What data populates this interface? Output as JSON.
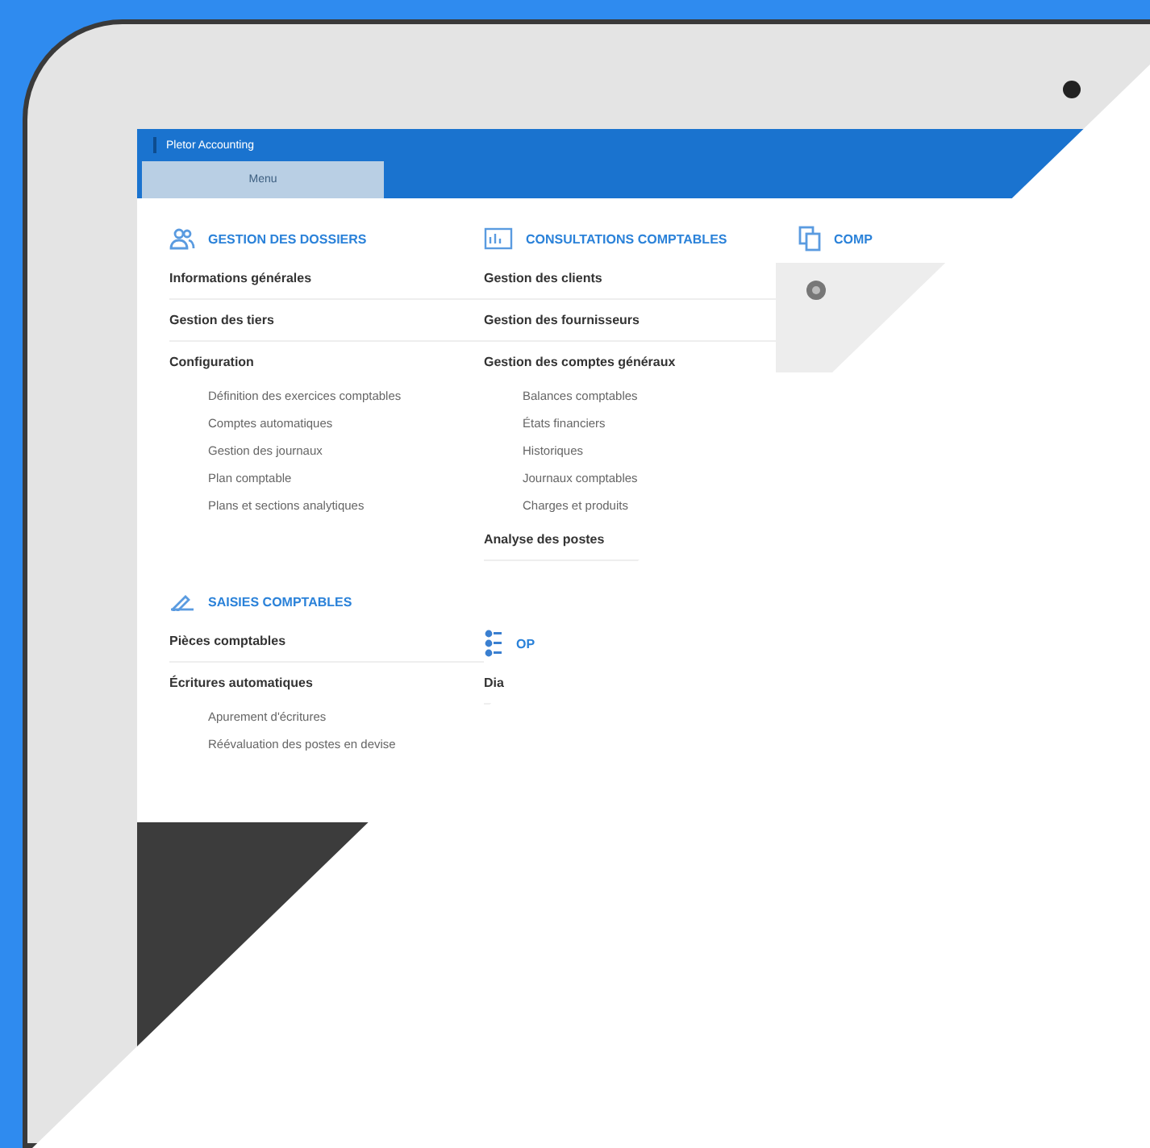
{
  "app": {
    "title": "Pletor Accounting",
    "tabs": [
      {
        "label": "Menu",
        "selected": true
      }
    ]
  },
  "columns": [
    {
      "sections": [
        {
          "title": "GESTION DES DOSSIERS",
          "items": [
            {
              "label": "Informations générales"
            },
            {
              "label": "Gestion des tiers"
            },
            {
              "label": "Configuration",
              "children": [
                {
                  "label": "Définition des exercices comptables"
                },
                {
                  "label": "Comptes automatiques"
                },
                {
                  "label": "Gestion des journaux"
                },
                {
                  "label": "Plan comptable"
                },
                {
                  "label": "Plans et sections analytiques"
                }
              ]
            }
          ]
        },
        {
          "title": "SAISIES COMPTABLES",
          "items": [
            {
              "label": "Pièces comptables"
            },
            {
              "label": "Écritures automatiques",
              "children": [
                {
                  "label": "Apurement d'écritures"
                },
                {
                  "label": "Réévaluation des postes en devise"
                }
              ]
            }
          ]
        }
      ]
    },
    {
      "sections": [
        {
          "title": "CONSULTATIONS COMPTABLES",
          "items": [
            {
              "label": "Gestion des clients"
            },
            {
              "label": "Gestion des fournisseurs"
            },
            {
              "label": "Gestion des comptes généraux",
              "children": [
                {
                  "label": "Balances comptables"
                },
                {
                  "label": "États financiers"
                },
                {
                  "label": "Historiques"
                },
                {
                  "label": "Journaux comptables"
                },
                {
                  "label": "Charges et produits"
                }
              ]
            },
            {
              "label": "Analyse des postes"
            }
          ]
        },
        {
          "title": "OP",
          "items": [
            {
              "label": "Dia"
            }
          ]
        }
      ]
    },
    {
      "sections": [
        {
          "title": "COMP",
          "kind": "panel"
        }
      ]
    }
  ]
}
